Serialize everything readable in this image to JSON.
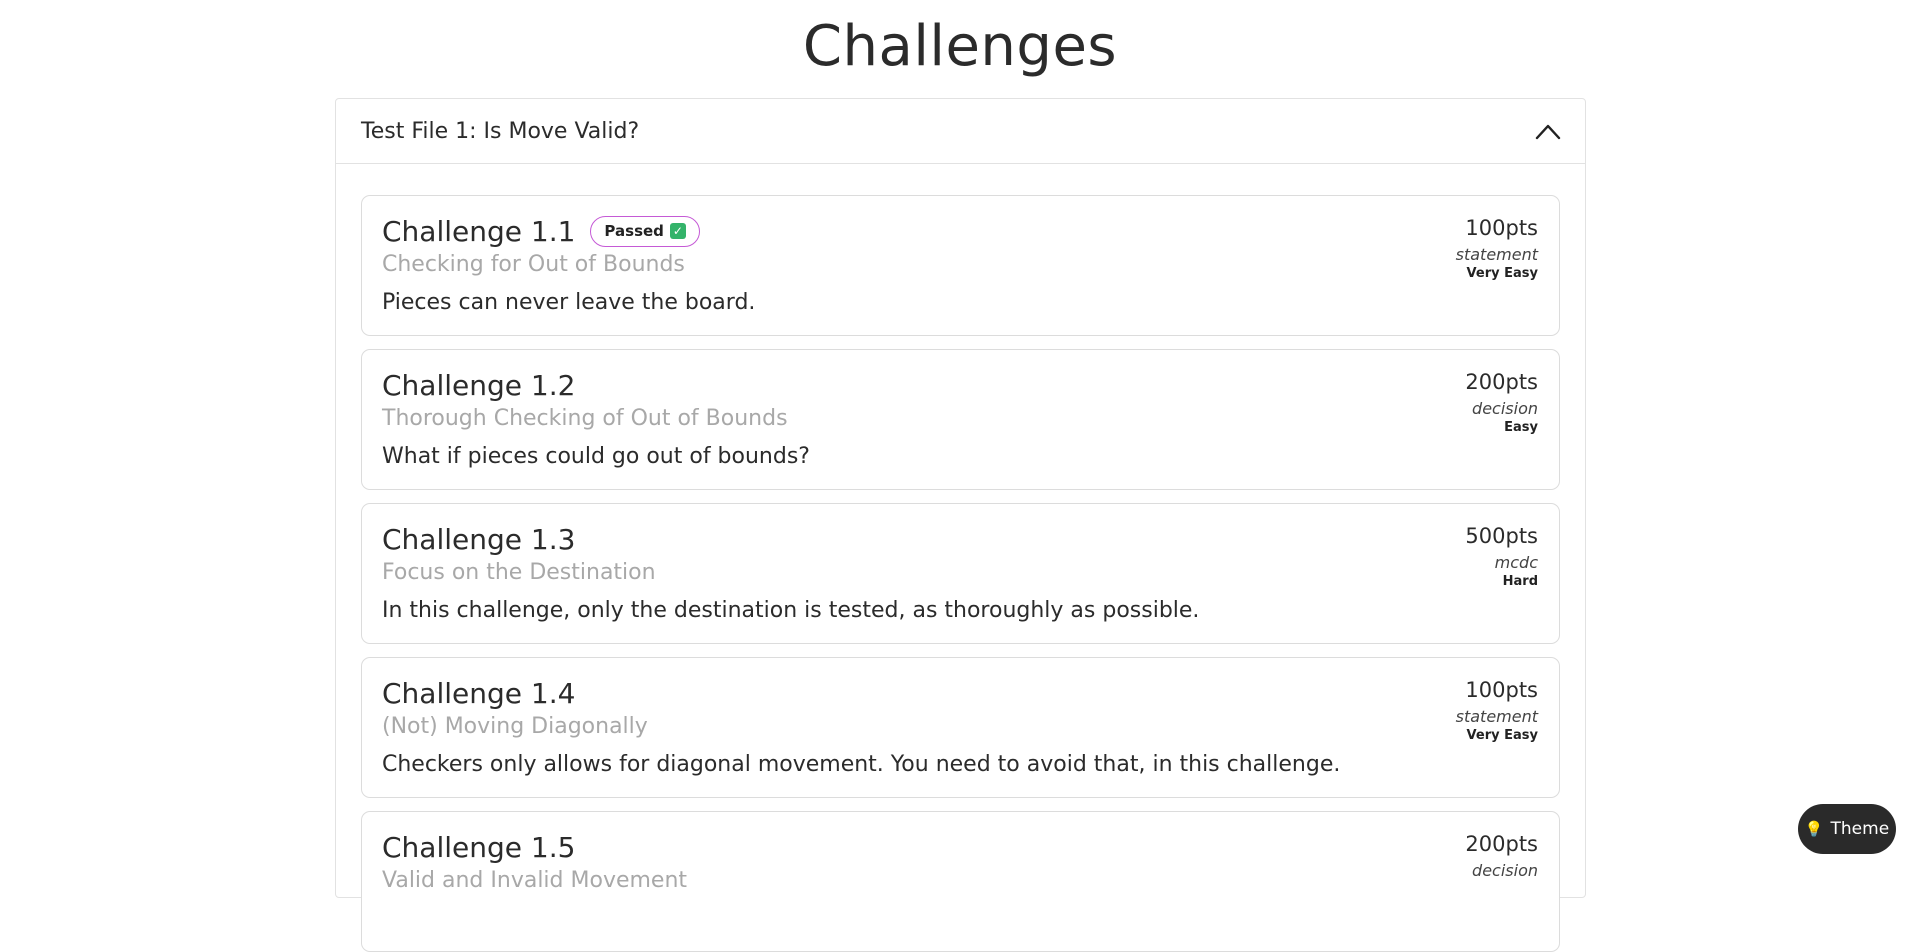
{
  "page": {
    "title": "Challenges"
  },
  "accordion": {
    "title": "Test File 1: Is Move Valid?",
    "expanded": true,
    "chevron_icon": "chevron-up-icon"
  },
  "challenges": [
    {
      "title": "Challenge 1.1",
      "badge": {
        "label": "Passed",
        "icon": "check-icon",
        "color": "#34b36a",
        "border_color": "#c55ad6"
      },
      "subtitle": "Checking for Out of Bounds",
      "description": "Pieces can never leave the board.",
      "points": "100pts",
      "coverage": "statement",
      "difficulty": "Very Easy"
    },
    {
      "title": "Challenge 1.2",
      "subtitle": "Thorough Checking of Out of Bounds",
      "description": "What if pieces could go out of bounds?",
      "points": "200pts",
      "coverage": "decision",
      "difficulty": "Easy"
    },
    {
      "title": "Challenge 1.3",
      "subtitle": "Focus on the Destination",
      "description": "In this challenge, only the destination is tested, as thoroughly as possible.",
      "points": "500pts",
      "coverage": "mcdc",
      "difficulty": "Hard"
    },
    {
      "title": "Challenge 1.4",
      "subtitle": "(Not) Moving Diagonally",
      "description": "Checkers only allows for diagonal movement. You need to avoid that, in this challenge.",
      "points": "100pts",
      "coverage": "statement",
      "difficulty": "Very Easy"
    },
    {
      "title": "Challenge 1.5",
      "subtitle": "Valid and Invalid Movement",
      "description": "",
      "points": "200pts",
      "coverage": "decision",
      "difficulty": ""
    }
  ],
  "theme_button": {
    "label": "Theme",
    "icon": "lightbulb-icon",
    "icon_glyph": "💡"
  }
}
